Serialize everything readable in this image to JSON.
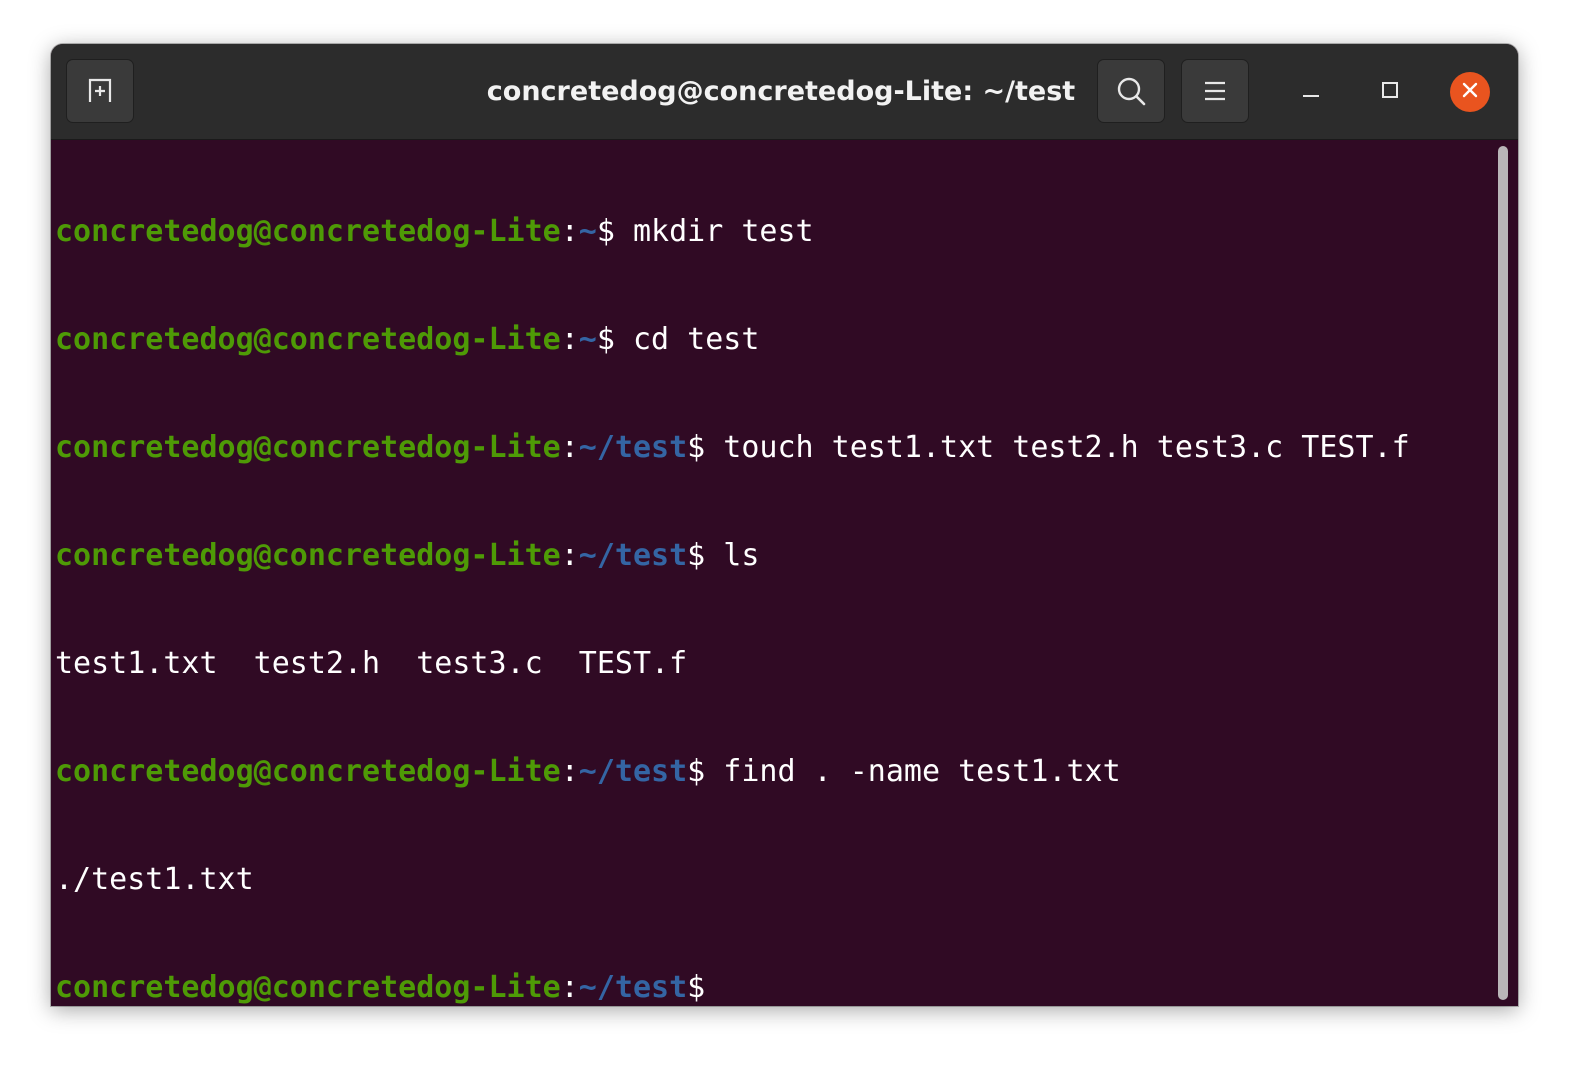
{
  "window": {
    "title": "concretedog@concretedog-Lite: ~/test"
  },
  "toolbar": {
    "new_tab_icon": "new-tab-icon",
    "search_icon": "search-icon",
    "menu_icon": "hamburger-menu-icon",
    "minimize_icon": "minimize-icon",
    "maximize_icon": "maximize-icon",
    "close_icon": "close-icon"
  },
  "terminal": {
    "lines": [
      {
        "user": "concretedog@concretedog-Lite",
        "sep": ":",
        "path": "~",
        "prompt": "$",
        "text": " mkdir test"
      },
      {
        "user": "concretedog@concretedog-Lite",
        "sep": ":",
        "path": "~",
        "prompt": "$",
        "text": " cd test"
      },
      {
        "user": "concretedog@concretedog-Lite",
        "sep": ":",
        "path": "~/test",
        "prompt": "$",
        "text": " touch test1.txt test2.h test3.c TEST.f"
      },
      {
        "user": "concretedog@concretedog-Lite",
        "sep": ":",
        "path": "~/test",
        "prompt": "$",
        "text": " ls"
      },
      {
        "output": "test1.txt  test2.h  test3.c  TEST.f"
      },
      {
        "user": "concretedog@concretedog-Lite",
        "sep": ":",
        "path": "~/test",
        "prompt": "$",
        "text": " find . -name test1.txt"
      },
      {
        "output": "./test1.txt"
      },
      {
        "user": "concretedog@concretedog-Lite",
        "sep": ":",
        "path": "~/test",
        "prompt": "$",
        "text": ""
      }
    ]
  },
  "colors": {
    "background": "#300a24",
    "user": "#4e9a06",
    "path": "#3465a4",
    "text": "#ffffff",
    "titlebar": "#2c2c2c",
    "close": "#e9541f"
  }
}
